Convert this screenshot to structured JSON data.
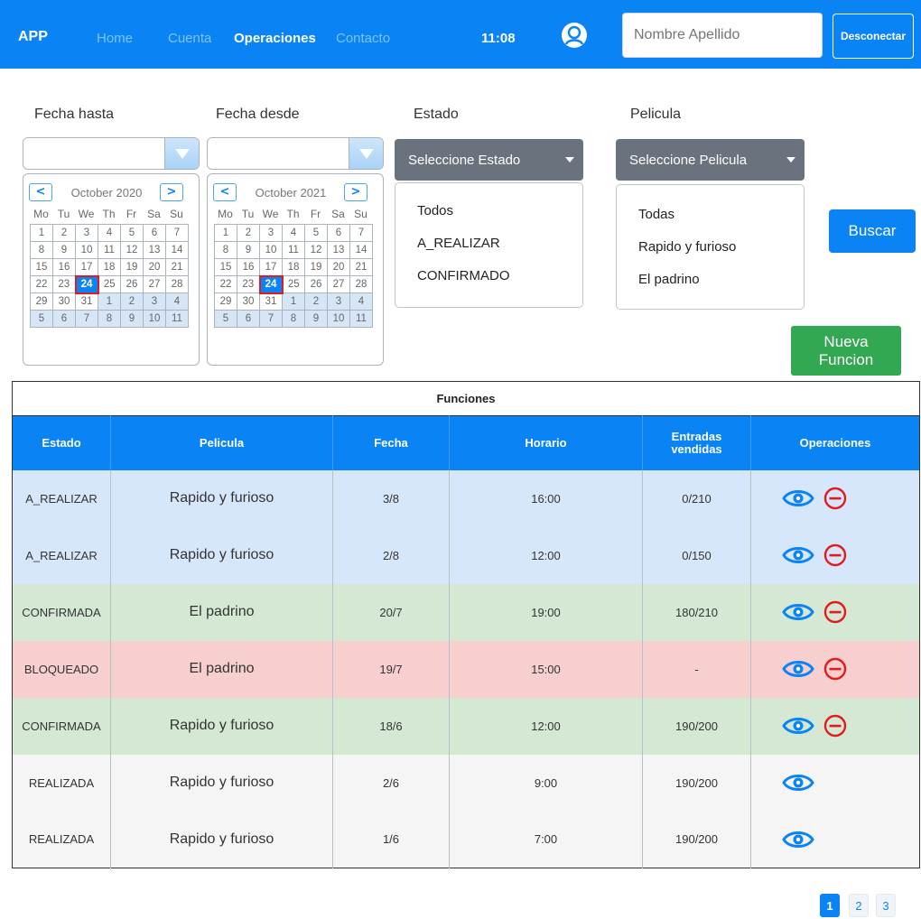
{
  "navbar": {
    "brand": "APP",
    "links": [
      {
        "label": "Home",
        "active": false
      },
      {
        "label": "Cuenta",
        "active": false
      },
      {
        "label": "Operaciones",
        "active": true
      },
      {
        "label": "Contacto",
        "active": false
      }
    ],
    "time": "11:08",
    "user_placeholder": "Nombre Apellido",
    "logout_label": "Desconectar"
  },
  "filters": {
    "fecha_hasta": {
      "label": "Fecha hasta",
      "value": "",
      "month_label": "October 2020",
      "weekdays": [
        "Mo",
        "Tu",
        "We",
        "Th",
        "Fr",
        "Sa",
        "Su"
      ],
      "days": [
        1,
        2,
        3,
        4,
        5,
        6,
        7,
        8,
        9,
        10,
        11,
        12,
        13,
        14,
        15,
        16,
        17,
        18,
        19,
        20,
        21,
        22,
        23,
        24,
        25,
        26,
        27,
        28,
        29,
        30,
        31,
        1,
        2,
        3,
        4,
        5,
        6,
        7,
        8,
        9,
        10,
        11
      ],
      "selected": 24
    },
    "fecha_desde": {
      "label": "Fecha desde",
      "value": "",
      "month_label": "October 2021",
      "weekdays": [
        "Mo",
        "Tu",
        "We",
        "Th",
        "Fr",
        "Sa",
        "Su"
      ],
      "days": [
        1,
        2,
        3,
        4,
        5,
        6,
        7,
        8,
        9,
        10,
        11,
        12,
        13,
        14,
        15,
        16,
        17,
        18,
        19,
        20,
        21,
        22,
        23,
        24,
        25,
        26,
        27,
        28,
        29,
        30,
        31,
        1,
        2,
        3,
        4,
        5,
        6,
        7,
        8,
        9,
        10,
        11
      ],
      "selected": 24
    },
    "estado": {
      "label": "Estado",
      "button": "Seleccione Estado",
      "options": [
        "Todos",
        "A_REALIZAR",
        "CONFIRMADO"
      ]
    },
    "pelicula": {
      "label": "Pelicula",
      "button": "Seleccione Pelicula",
      "options": [
        "Todas",
        "Rapido y furioso",
        "El padrino"
      ]
    },
    "search_label": "Buscar",
    "new_label_line1": "Nueva",
    "new_label_line2": "Funcion"
  },
  "table": {
    "title": "Funciones",
    "headers": {
      "estado": "Estado",
      "pelicula": "Pelicula",
      "fecha": "Fecha",
      "horario": "Horario",
      "entradas_line1": "Entradas",
      "entradas_line2": "vendidas",
      "operaciones": "Operaciones"
    },
    "rows": [
      {
        "estado": "A_REALIZAR",
        "pelicula": "Rapido y furioso",
        "fecha": "3/8",
        "horario": "16:00",
        "entradas": "0/210",
        "tone": "blue",
        "can_delete": true
      },
      {
        "estado": "A_REALIZAR",
        "pelicula": "Rapido y furioso",
        "fecha": "2/8",
        "horario": "12:00",
        "entradas": "0/150",
        "tone": "blue",
        "can_delete": true
      },
      {
        "estado": "CONFIRMADA",
        "pelicula": "El padrino",
        "fecha": "20/7",
        "horario": "19:00",
        "entradas": "180/210",
        "tone": "green",
        "can_delete": true
      },
      {
        "estado": "BLOQUEADO",
        "pelicula": "El padrino",
        "fecha": "19/7",
        "horario": "15:00",
        "entradas": "-",
        "tone": "red",
        "can_delete": true
      },
      {
        "estado": "CONFIRMADA",
        "pelicula": "Rapido y furioso",
        "fecha": "18/6",
        "horario": "12:00",
        "entradas": "190/200",
        "tone": "green",
        "can_delete": true
      },
      {
        "estado": "REALIZADA",
        "pelicula": "Rapido y furioso",
        "fecha": "2/6",
        "horario": "9:00",
        "entradas": "190/200",
        "tone": "gray",
        "can_delete": false
      },
      {
        "estado": "REALIZADA",
        "pelicula": "Rapido y furioso",
        "fecha": "1/6",
        "horario": "7:00",
        "entradas": "190/200",
        "tone": "gray",
        "can_delete": false
      }
    ]
  },
  "pagination": {
    "pages": [
      "1",
      "2",
      "3"
    ],
    "active": "1"
  },
  "icons": {
    "view": "eye-icon",
    "delete": "minus-circle-icon",
    "avatar": "user-circle-icon",
    "date_drop": "triangle-down-icon"
  },
  "colors": {
    "primary": "#0a84f5",
    "success": "#33a853",
    "danger": "#e21c1c",
    "row_blue": "#d7e7fb",
    "row_green": "#d5e8d4",
    "row_red": "#f7cfcf",
    "row_gray": "#f5f5f5"
  }
}
